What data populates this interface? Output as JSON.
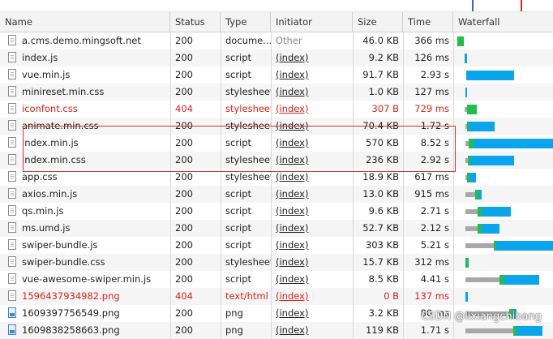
{
  "headers": {
    "name": "Name",
    "status": "Status",
    "type": "Type",
    "initiator": "Initiator",
    "size": "Size",
    "time": "Time",
    "waterfall": "Waterfall"
  },
  "colors": {
    "error": "#e0231c",
    "waiting": "#a8a8a8",
    "ttfb": "#1fbf4c",
    "download": "#0aa5ea",
    "highlight": "#d23434"
  },
  "rows": [
    {
      "name": "a.cms.demo.mingsoft.net",
      "status": "200",
      "type": "docume...",
      "initiator": "Other",
      "size": "46.0 KB",
      "time": "366 ms",
      "icon": "document-icon",
      "error": false
    },
    {
      "name": "index.js",
      "status": "200",
      "type": "script",
      "initiator": "(index)",
      "size": "9.2 KB",
      "time": "126 ms",
      "icon": "file-icon",
      "error": false
    },
    {
      "name": "vue.min.js",
      "status": "200",
      "type": "script",
      "initiator": "(index)",
      "size": "91.7 KB",
      "time": "2.93 s",
      "icon": "file-icon",
      "error": false
    },
    {
      "name": "minireset.min.css",
      "status": "200",
      "type": "stylesheet",
      "initiator": "(index)",
      "size": "1.0 KB",
      "time": "127 ms",
      "icon": "file-icon",
      "error": false
    },
    {
      "name": "iconfont.css",
      "status": "404",
      "type": "stylesheet",
      "initiator": "(index)",
      "size": "307 B",
      "time": "729 ms",
      "icon": "file-icon",
      "error": true
    },
    {
      "name": "animate.min.css",
      "status": "200",
      "type": "stylesheet",
      "initiator": "(index)",
      "size": "70.4 KB",
      "time": "1.72 s",
      "icon": "file-icon",
      "error": false
    },
    {
      "name": "index.min.js",
      "status": "200",
      "type": "script",
      "initiator": "(index)",
      "size": "570 KB",
      "time": "8.52 s",
      "icon": "file-icon",
      "error": false
    },
    {
      "name": "index.min.css",
      "status": "200",
      "type": "stylesheet",
      "initiator": "(index)",
      "size": "236 KB",
      "time": "2.92 s",
      "icon": "file-icon",
      "error": false
    },
    {
      "name": "app.css",
      "status": "200",
      "type": "stylesheet",
      "initiator": "(index)",
      "size": "18.9 KB",
      "time": "617 ms",
      "icon": "file-icon",
      "error": false
    },
    {
      "name": "axios.min.js",
      "status": "200",
      "type": "script",
      "initiator": "(index)",
      "size": "13.0 KB",
      "time": "915 ms",
      "icon": "file-icon",
      "error": false
    },
    {
      "name": "qs.min.js",
      "status": "200",
      "type": "script",
      "initiator": "(index)",
      "size": "9.6 KB",
      "time": "2.71 s",
      "icon": "file-icon",
      "error": false
    },
    {
      "name": "ms.umd.js",
      "status": "200",
      "type": "script",
      "initiator": "(index)",
      "size": "52.7 KB",
      "time": "2.12 s",
      "icon": "file-icon",
      "error": false
    },
    {
      "name": "swiper-bundle.js",
      "status": "200",
      "type": "script",
      "initiator": "(index)",
      "size": "303 KB",
      "time": "5.21 s",
      "icon": "file-icon",
      "error": false
    },
    {
      "name": "swiper-bundle.css",
      "status": "200",
      "type": "stylesheet",
      "initiator": "(index)",
      "size": "15.7 KB",
      "time": "312 ms",
      "icon": "file-icon",
      "error": false
    },
    {
      "name": "vue-awesome-swiper.min.js",
      "status": "200",
      "type": "script",
      "initiator": "(index)",
      "size": "8.5 KB",
      "time": "4.41 s",
      "icon": "file-icon",
      "error": false
    },
    {
      "name": "1596437934982.png",
      "status": "404",
      "type": "text/html",
      "initiator": "(index)",
      "size": "0 B",
      "time": "137 ms",
      "icon": "file-icon",
      "error": true
    },
    {
      "name": "1609397756549.png",
      "status": "200",
      "type": "png",
      "initiator": "(index)",
      "size": "3.2 KB",
      "time": "80 ms",
      "icon": "image-icon",
      "error": false
    },
    {
      "name": "1609838258663.png",
      "status": "200",
      "type": "png",
      "initiator": "(index)",
      "size": "119 KB",
      "time": "1.71 s",
      "icon": "image-icon",
      "error": false
    }
  ],
  "waterfall": [
    [
      {
        "k": "ttfb",
        "s": 0,
        "e": 8
      }
    ],
    [
      {
        "k": "download",
        "s": 9,
        "e": 12
      }
    ],
    [
      {
        "k": "download",
        "s": 11,
        "e": 70
      }
    ],
    [
      {
        "k": "download",
        "s": 10,
        "e": 12
      }
    ],
    [
      {
        "k": "waiting",
        "s": 9,
        "e": 12
      },
      {
        "k": "ttfb",
        "s": 12,
        "e": 24
      }
    ],
    [
      {
        "k": "waiting",
        "s": 10,
        "e": 12
      },
      {
        "k": "ttfb",
        "s": 12,
        "e": 14
      },
      {
        "k": "download",
        "s": 14,
        "e": 46
      }
    ],
    [
      {
        "k": "waiting",
        "s": 10,
        "e": 14
      },
      {
        "k": "ttfb",
        "s": 14,
        "e": 20
      },
      {
        "k": "download",
        "s": 20,
        "e": 123
      }
    ],
    [
      {
        "k": "waiting",
        "s": 10,
        "e": 13
      },
      {
        "k": "ttfb",
        "s": 13,
        "e": 16
      },
      {
        "k": "download",
        "s": 16,
        "e": 70
      }
    ],
    [
      {
        "k": "waiting",
        "s": 10,
        "e": 12
      },
      {
        "k": "ttfb",
        "s": 12,
        "e": 15
      },
      {
        "k": "download",
        "s": 15,
        "e": 23
      }
    ],
    [
      {
        "k": "waiting",
        "s": 10,
        "e": 22
      },
      {
        "k": "ttfb",
        "s": 22,
        "e": 26
      },
      {
        "k": "download",
        "s": 26,
        "e": 30
      }
    ],
    [
      {
        "k": "waiting",
        "s": 10,
        "e": 25
      },
      {
        "k": "ttfb",
        "s": 25,
        "e": 30
      },
      {
        "k": "download",
        "s": 30,
        "e": 66
      }
    ],
    [
      {
        "k": "waiting",
        "s": 10,
        "e": 25
      },
      {
        "k": "ttfb",
        "s": 25,
        "e": 30
      },
      {
        "k": "download",
        "s": 30,
        "e": 52
      }
    ],
    [
      {
        "k": "waiting",
        "s": 10,
        "e": 45
      },
      {
        "k": "ttfb",
        "s": 45,
        "e": 48
      },
      {
        "k": "download",
        "s": 48,
        "e": 118
      }
    ],
    [
      {
        "k": "ttfb",
        "s": 10,
        "e": 13
      },
      {
        "k": "download",
        "s": 13,
        "e": 14
      }
    ],
    [
      {
        "k": "waiting",
        "s": 10,
        "e": 52
      },
      {
        "k": "ttfb",
        "s": 52,
        "e": 58
      },
      {
        "k": "download",
        "s": 58,
        "e": 101
      }
    ],
    [
      {
        "k": "download",
        "s": 10,
        "e": 13
      }
    ],
    [
      {
        "k": "waiting",
        "s": 10,
        "e": 64
      },
      {
        "k": "ttfb",
        "s": 64,
        "e": 70
      },
      {
        "k": "download",
        "s": 70,
        "e": 73
      }
    ],
    [
      {
        "k": "waiting",
        "s": 10,
        "e": 69
      },
      {
        "k": "ttfb",
        "s": 69,
        "e": 73
      },
      {
        "k": "download",
        "s": 73,
        "e": 105
      }
    ]
  ],
  "watermark": "CSDN @lixiangchibang"
}
